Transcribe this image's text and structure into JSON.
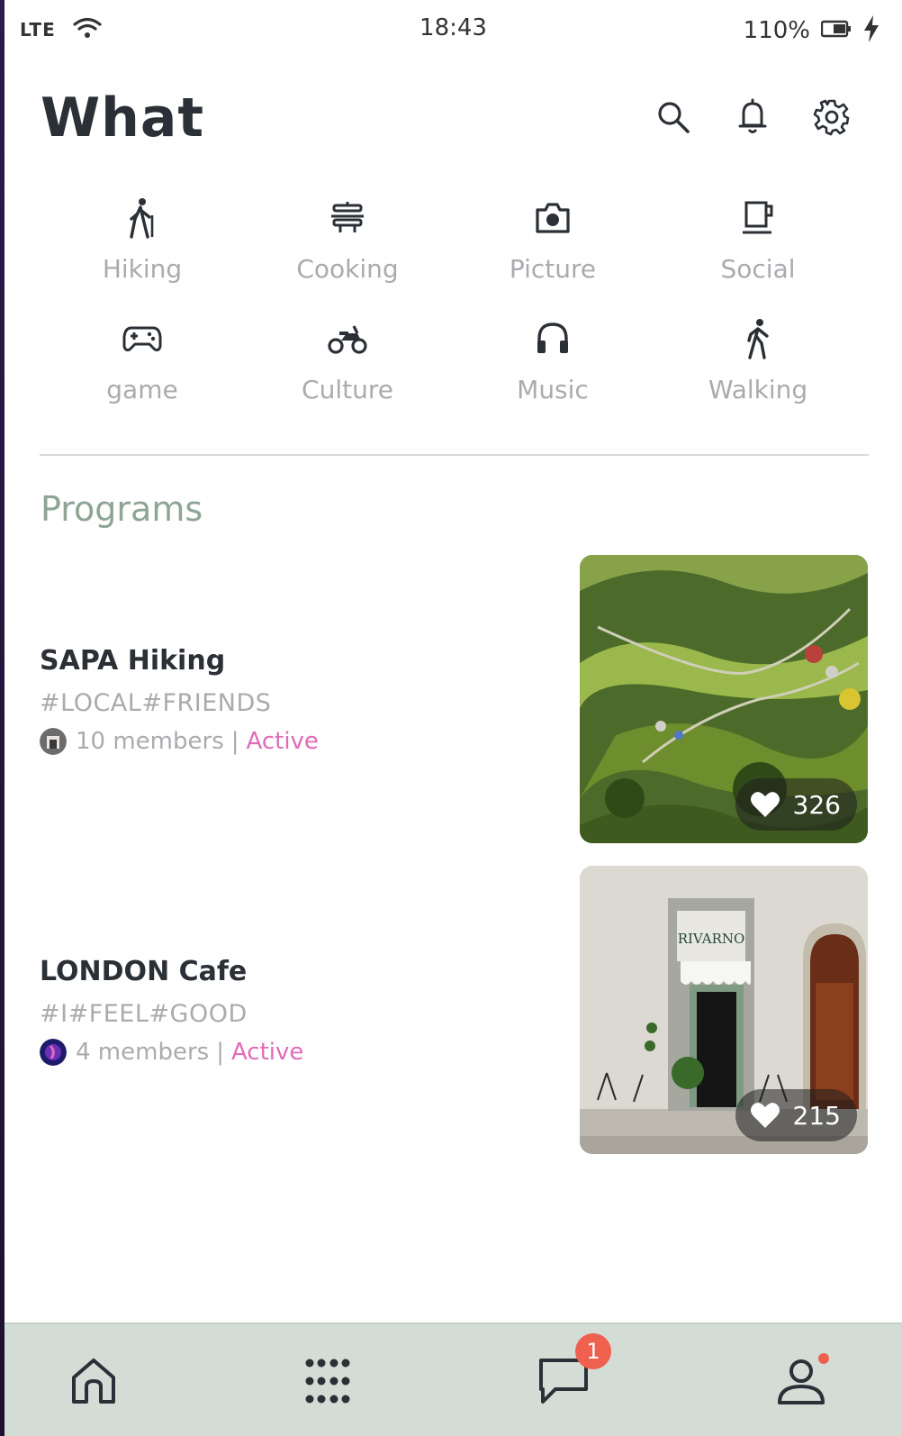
{
  "status_bar": {
    "network": "LTE",
    "time": "18:43",
    "battery": "110%"
  },
  "header": {
    "title": "What"
  },
  "categories": [
    {
      "label": "Hiking",
      "icon": "hiking-icon"
    },
    {
      "label": "Cooking",
      "icon": "cooking-icon"
    },
    {
      "label": "Picture",
      "icon": "camera-icon"
    },
    {
      "label": "Social",
      "icon": "cup-icon"
    },
    {
      "label": "game",
      "icon": "gamepad-icon"
    },
    {
      "label": "Culture",
      "icon": "motorbike-icon"
    },
    {
      "label": "Music",
      "icon": "headphones-icon"
    },
    {
      "label": "Walking",
      "icon": "walking-icon"
    }
  ],
  "programs_section": {
    "title": "Programs"
  },
  "programs": [
    {
      "title": "SAPA Hiking",
      "tags": "#LOCAL#FRIENDS",
      "members": "10 members",
      "separator": "|",
      "status": "Active",
      "likes": "326"
    },
    {
      "title": "LONDON Cafe",
      "tags": "#I#FEEL#GOOD",
      "members": "4 members",
      "separator": "|",
      "status": "Active",
      "likes": "215"
    }
  ],
  "bottom_nav": {
    "items": [
      {
        "icon": "home-icon"
      },
      {
        "icon": "apps-grid-icon"
      },
      {
        "icon": "chat-icon",
        "badge": "1"
      },
      {
        "icon": "profile-icon"
      }
    ]
  },
  "colors": {
    "accent_green": "#8ea596",
    "active_pink": "#e06bb7",
    "badge_red": "#f0604f",
    "nav_bg": "#d3ddd6"
  }
}
